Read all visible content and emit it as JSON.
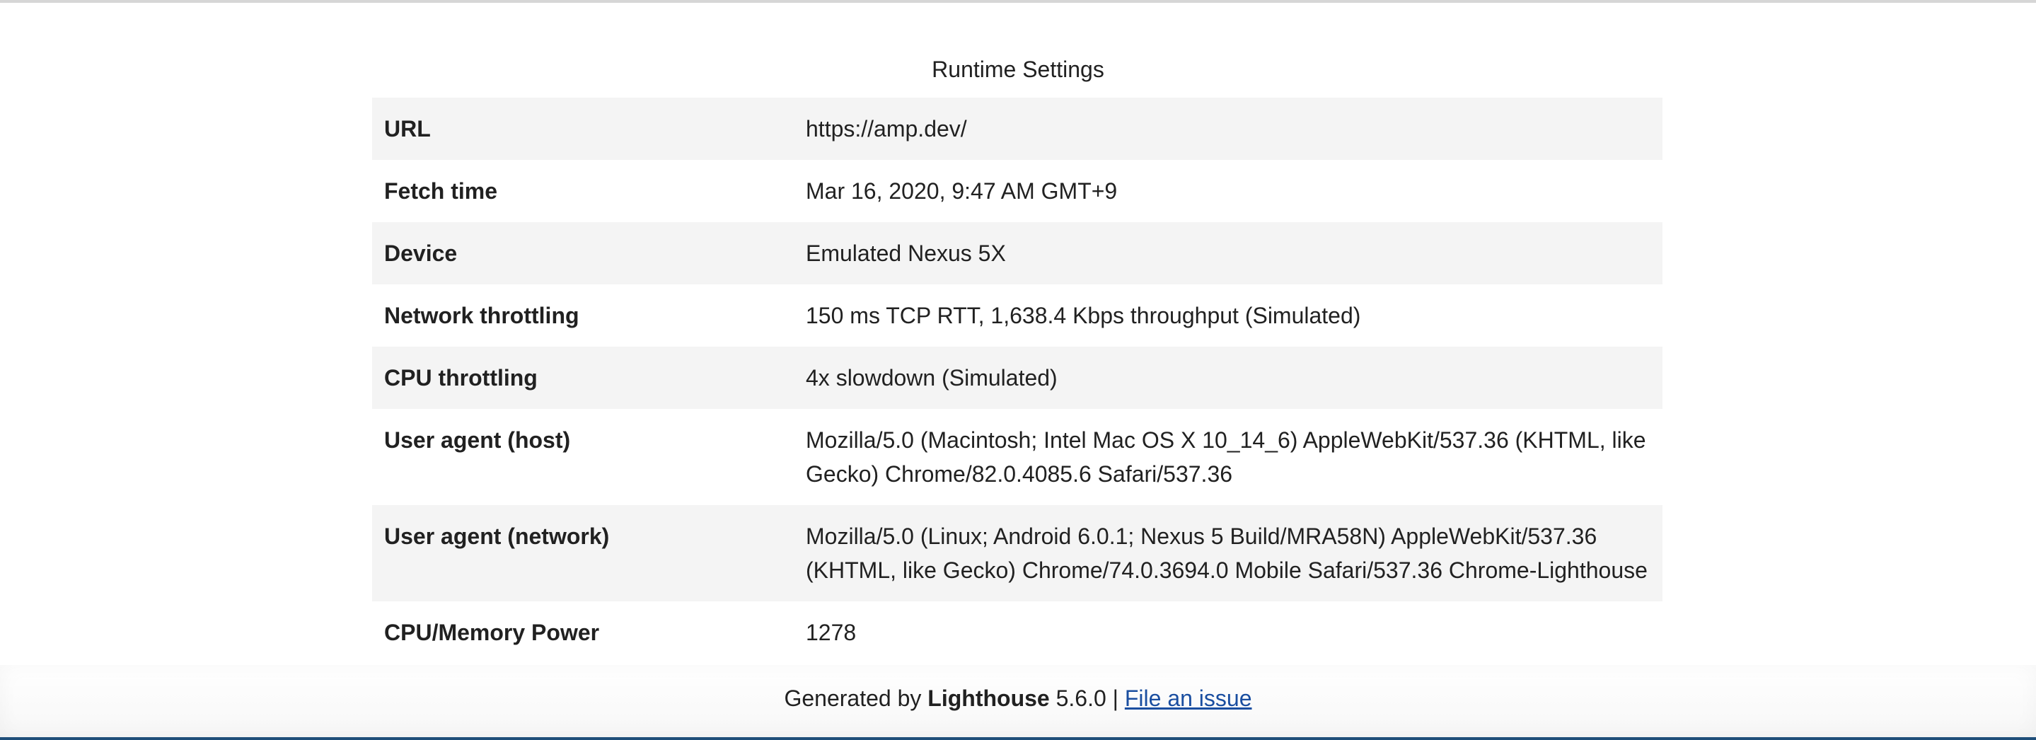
{
  "section_title": "Runtime Settings",
  "settings": [
    {
      "label": "URL",
      "value": "https://amp.dev/"
    },
    {
      "label": "Fetch time",
      "value": "Mar 16, 2020, 9:47 AM GMT+9"
    },
    {
      "label": "Device",
      "value": "Emulated Nexus 5X"
    },
    {
      "label": "Network throttling",
      "value": "150 ms TCP RTT, 1,638.4 Kbps throughput (Simulated)"
    },
    {
      "label": "CPU throttling",
      "value": "4x slowdown (Simulated)"
    },
    {
      "label": "User agent (host)",
      "value_line1": "Mozilla/5.0 (Macintosh; Intel Mac OS X 10_14_6) AppleWebKit/537.36 (KHTML, like",
      "value_line2": "Gecko) Chrome/82.0.4085.6 Safari/537.36"
    },
    {
      "label": "User agent (network)",
      "value_line1": "Mozilla/5.0 (Linux; Android 6.0.1; Nexus 5 Build/MRA58N) AppleWebKit/537.36",
      "value_line2": "(KHTML, like Gecko) Chrome/74.0.3694.0 Mobile Safari/537.36 Chrome-Lighthouse"
    },
    {
      "label": "CPU/Memory Power",
      "value": "1278"
    }
  ],
  "footer": {
    "generated_by": "Generated by",
    "tool_name": "Lighthouse",
    "version": "5.6.0",
    "separator": "|",
    "issue_link": "File an issue"
  },
  "colors": {
    "row_shade": "#f4f4f4",
    "text": "#212121",
    "link": "#1a4ea0",
    "bottom_accent": "#1f4e79"
  }
}
